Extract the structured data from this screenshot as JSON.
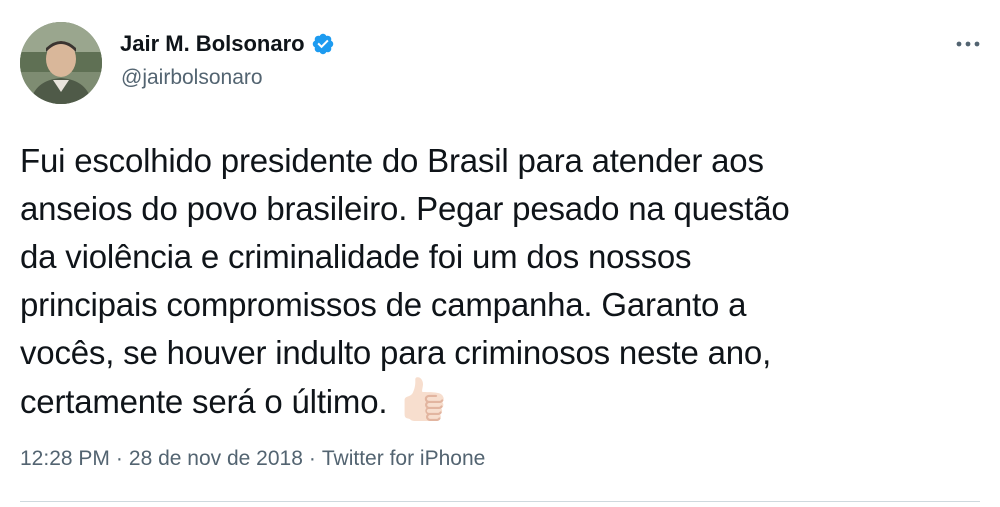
{
  "author": {
    "display_name": "Jair M. Bolsonaro",
    "handle": "@jairbolsonaro",
    "verified": true,
    "verified_color": "#1d9bf0"
  },
  "tweet": {
    "lines": [
      "Fui escolhido presidente do Brasil para atender aos",
      "anseios do povo brasileiro. Pegar pesado na questão",
      "da violência e criminalidade foi um dos nossos",
      "principais compromissos de campanha. Garanto a",
      "vocês, se houver indulto para criminosos neste ano,",
      "certamente será o último."
    ],
    "emoji": "thumbs-up-icon"
  },
  "meta": {
    "time": "12:28 PM",
    "separator": "·",
    "date": "28 de nov de 2018",
    "source": "Twitter for iPhone"
  },
  "colors": {
    "text_primary": "#0f1419",
    "text_secondary": "#536471",
    "divider": "#cfd9de"
  },
  "icons": {
    "more": "more-options-icon",
    "verified": "verified-badge-icon"
  }
}
